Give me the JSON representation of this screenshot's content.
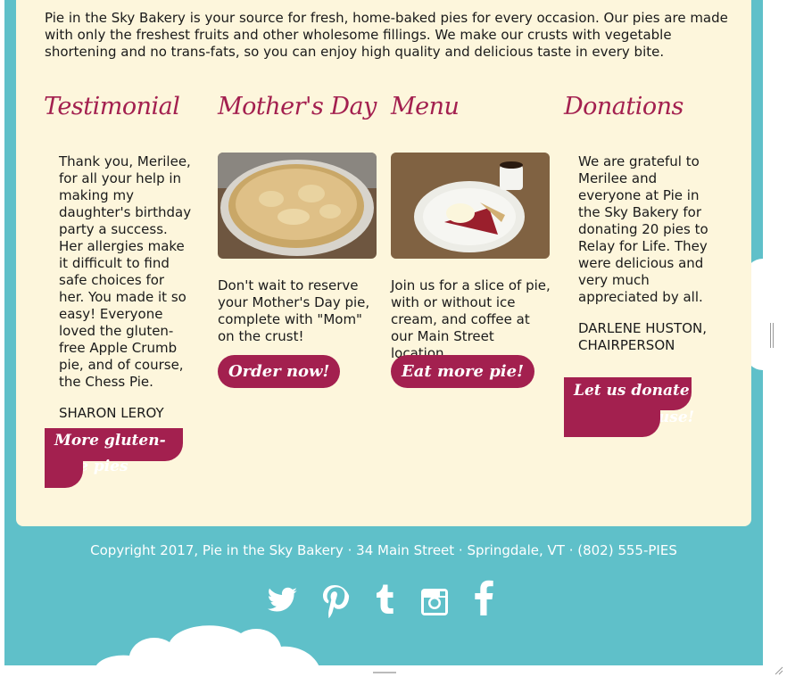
{
  "intro": "Pie in the Sky Bakery is your source for fresh, home-baked pies for every occasion. Our pies are made with only the freshest fruits and other wholesome fillings. We make our crusts with vegetable shortening and no trans-fats, so you can enjoy high quality and delicious taste in every bite.",
  "columns": [
    {
      "heading": "Testimonial",
      "paragraphs": [
        "Thank you, Merilee, for all your help in making my daughter's birthday party a success. Her allergies make it difficult to find safe choices for her. You made it so easy! Everyone loved the gluten-free Apple Crumb pie, and of course, the Chess Pie.",
        "SHARON LEROY"
      ],
      "button": "More gluten-free pies"
    },
    {
      "heading": "Mother's Day",
      "image": "whole-pie-photo",
      "paragraphs": [
        "Don't wait to reserve your Mother's Day pie, complete with \"Mom\" on the crust!"
      ],
      "button": "Order now!"
    },
    {
      "heading": "Menu",
      "image": "pie-slice-coffee-photo",
      "paragraphs": [
        "Join us for a slice of pie, with or without ice cream, and coffee at our Main Street location."
      ],
      "button": "Eat more pie!"
    },
    {
      "heading": "Donations",
      "paragraphs": [
        "We are grateful to Merilee and everyone at Pie in the Sky Bakery for donating 20 pies to Relay for Life. They were delicious and very much appreciated by all.",
        "DARLENE HUSTON, CHAIRPERSON"
      ],
      "button": "Let us donate to your cause!"
    }
  ],
  "footer": {
    "copyright": "Copyright 2017, Pie in the Sky Bakery · 34 Main Street · Springdale, VT · (802) 555-PIES",
    "social": [
      "twitter-icon",
      "pinterest-icon",
      "tumblr-icon",
      "instagram-icon",
      "facebook-icon"
    ]
  },
  "colors": {
    "accent": "#a3204f",
    "background": "#5fc0c9",
    "card": "#fdf6dc"
  }
}
